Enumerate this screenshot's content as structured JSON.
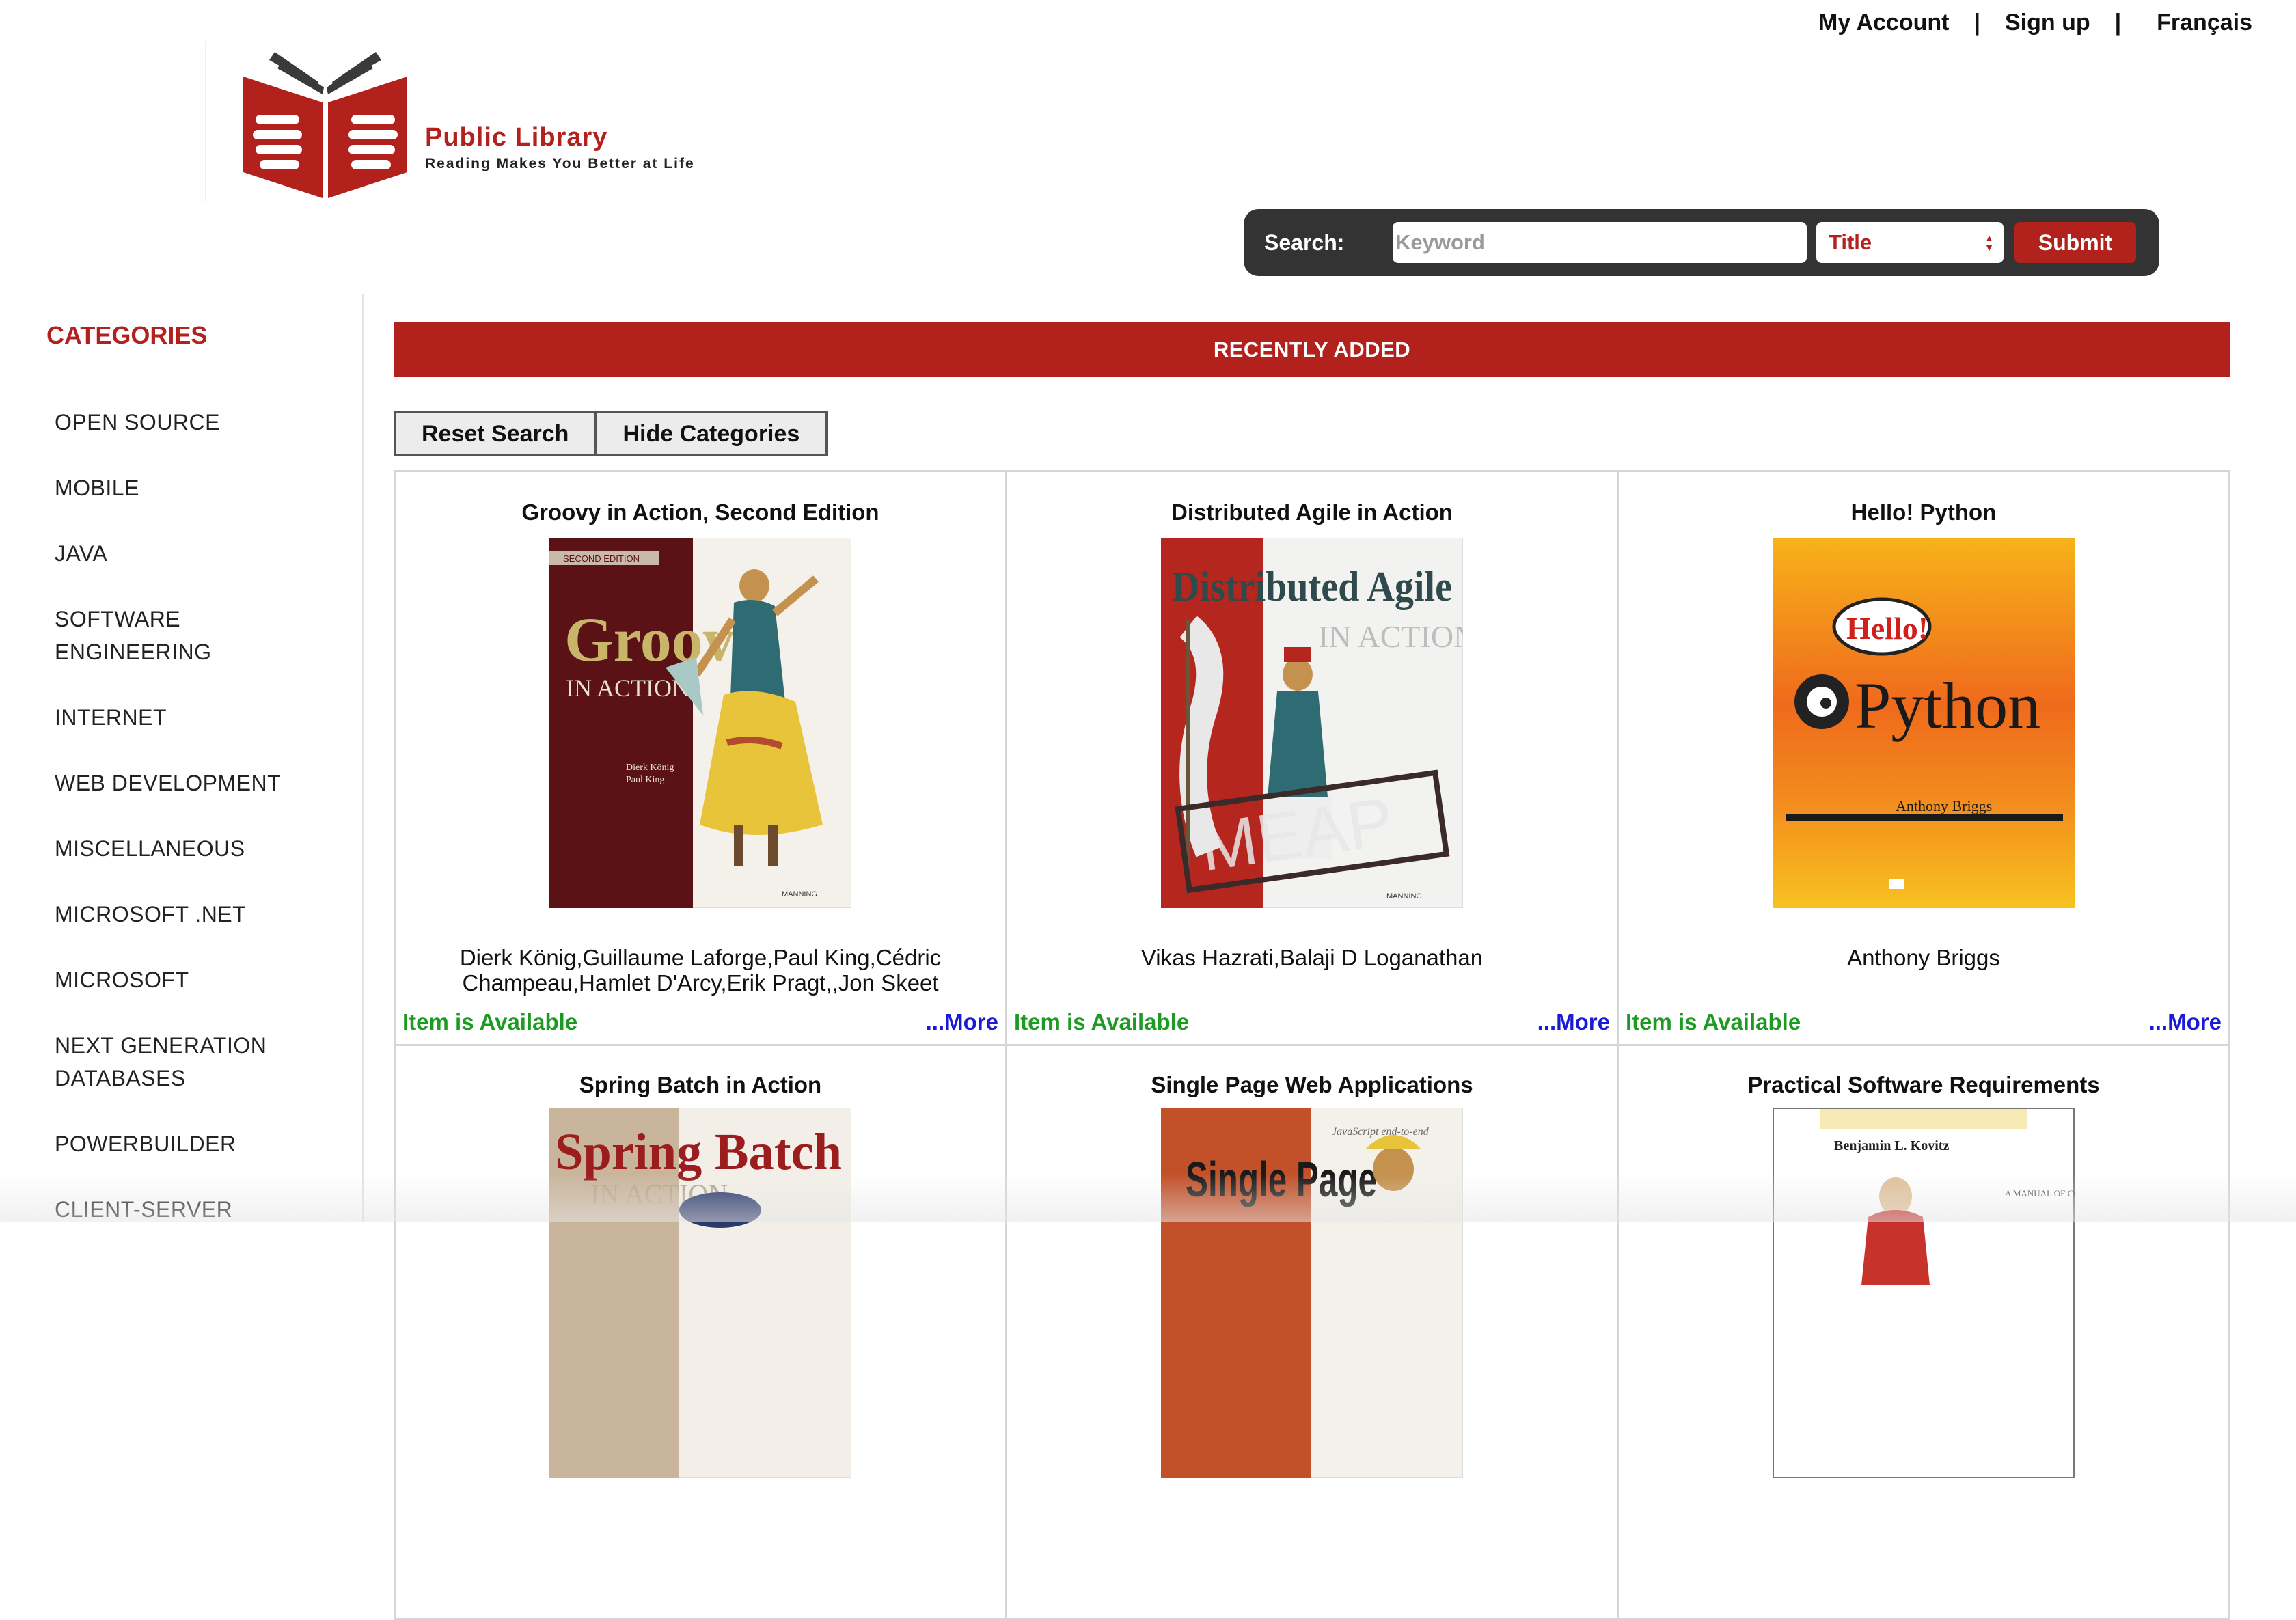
{
  "header": {
    "links": {
      "account": "My Account",
      "sep1": "|",
      "signup": "Sign up",
      "sep2": "|",
      "language": "Français"
    },
    "logo": {
      "title": "Public Library",
      "tagline": "Reading Makes You Better at Life"
    }
  },
  "search": {
    "label": "Search:",
    "placeholder": "Keyword",
    "field_selected": "Title",
    "submit_label": "Submit"
  },
  "sidebar": {
    "title": "CATEGORIES",
    "items": [
      "OPEN SOURCE",
      "MOBILE",
      "JAVA",
      "SOFTWARE ENGINEERING",
      "INTERNET",
      "WEB DEVELOPMENT",
      "MISCELLANEOUS",
      "MICROSOFT .NET",
      "MICROSOFT",
      "NEXT GENERATION DATABASES",
      "POWERBUILDER",
      "CLIENT-SERVER"
    ]
  },
  "main": {
    "banner": "RECENTLY ADDED",
    "reset_label": "Reset Search",
    "hide_label": "Hide Categories",
    "books": [
      {
        "title": "Groovy in Action, Second Edition",
        "authors": "Dierk König,Guillaume Laforge,Paul King,Cédric Champeau,Hamlet D'Arcy,Erik Pragt,,Jon Skeet",
        "status": "Item is Available",
        "more": "...More",
        "cover": {
          "edition": "SECOND EDITION",
          "word1": "Groovy",
          "word2": "IN ACTION",
          "publisher": "MANNING"
        }
      },
      {
        "title": "Distributed Agile in Action",
        "authors": "Vikas Hazrati,Balaji D Loganathan",
        "status": "Item is Available",
        "more": "...More",
        "cover": {
          "word1": "Distributed Agile",
          "word2": "IN ACTION",
          "stamp": "MEAP",
          "publisher": "MANNING"
        }
      },
      {
        "title": "Hello! Python",
        "authors": "Anthony Briggs",
        "status": "Item is Available",
        "more": "...More",
        "cover": {
          "bubble": "Hello!",
          "word1": "Python",
          "author": "Anthony Briggs"
        }
      },
      {
        "title": "Spring Batch in Action",
        "cover": {
          "word1": "Spring Batch",
          "word2": "IN ACTION"
        }
      },
      {
        "title": "Single Page Web Applications",
        "cover": {
          "word0": "JavaScript end-to-end",
          "word1": "Single Page"
        }
      },
      {
        "title": "Practical Software Requirements",
        "cover": {
          "author": "Benjamin L. Kovitz",
          "sub": "A MANUAL OF CONTENT"
        }
      }
    ]
  },
  "colors": {
    "brand": "#b3211d",
    "available": "#1c9a22",
    "more_link": "#1b1bd6",
    "searchbar": "#333333"
  }
}
